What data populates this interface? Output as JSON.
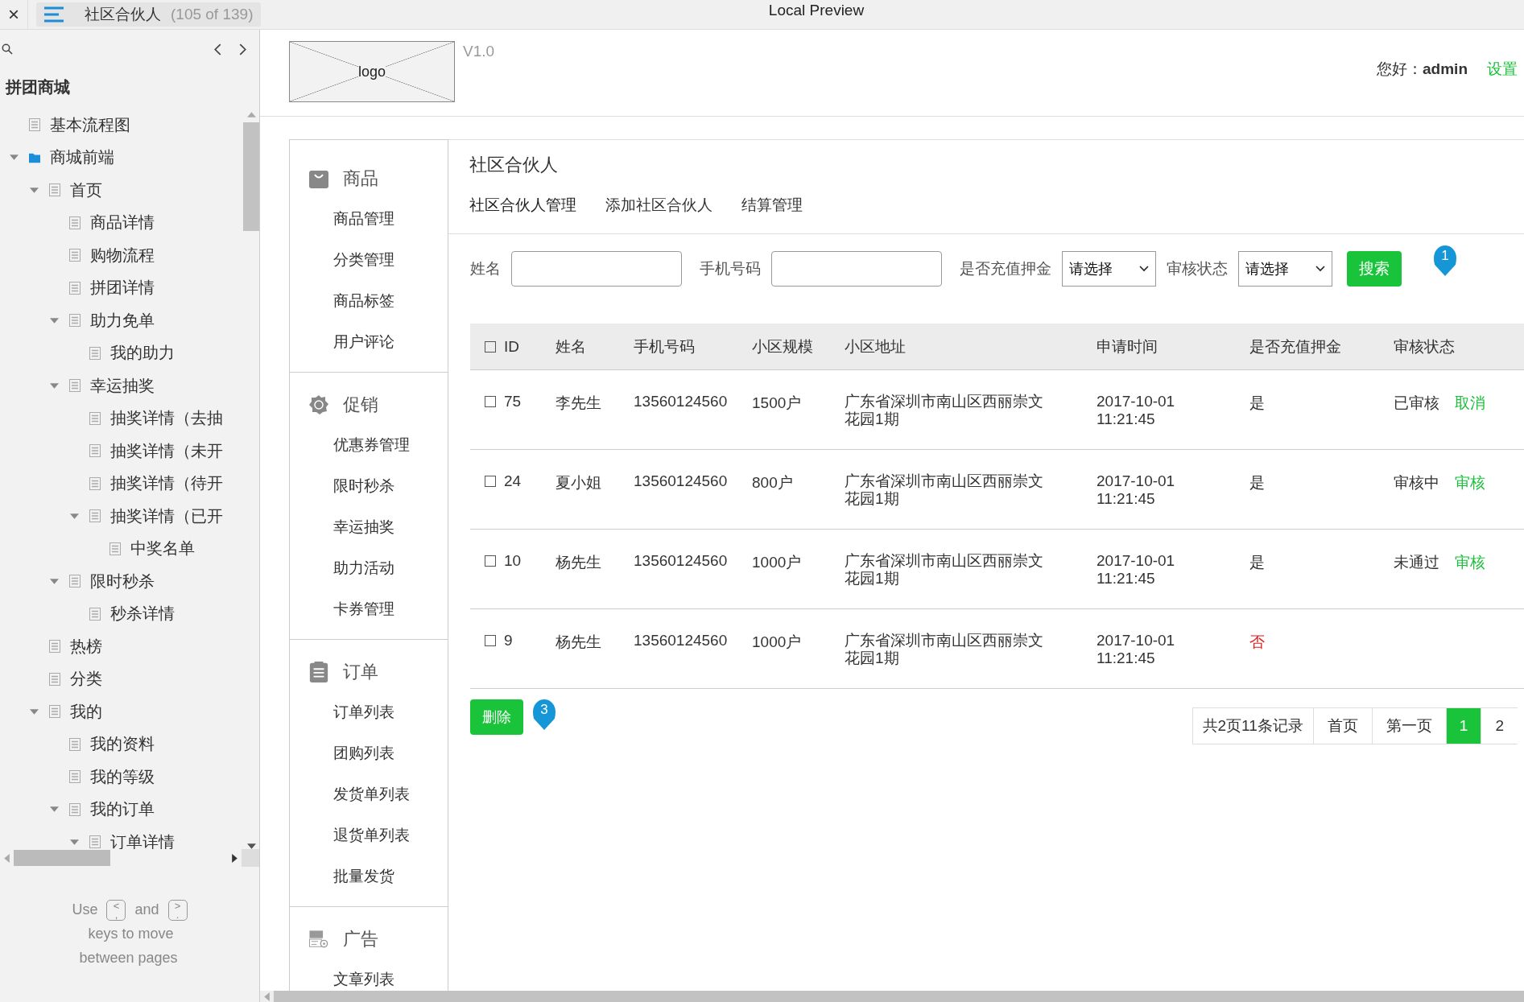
{
  "top_bar": {
    "close": "×",
    "tab_title": "社区合伙人",
    "tab_count": "(105 of 139)",
    "preview_title": "Local Preview"
  },
  "sidebar": {
    "project": "拼团商城",
    "tree": [
      {
        "label": "基本流程图",
        "kind": "page"
      },
      {
        "label": "商城前端",
        "kind": "folder",
        "expanded": true,
        "children": [
          {
            "label": "首页",
            "kind": "page",
            "expanded": true,
            "children": [
              {
                "label": "商品详情",
                "kind": "page"
              },
              {
                "label": "购物流程",
                "kind": "page"
              },
              {
                "label": "拼团详情",
                "kind": "page"
              },
              {
                "label": "助力免单",
                "kind": "page",
                "expanded": true,
                "children": [
                  {
                    "label": "我的助力",
                    "kind": "page"
                  }
                ]
              },
              {
                "label": "幸运抽奖",
                "kind": "page",
                "expanded": true,
                "children": [
                  {
                    "label": "抽奖详情（去抽",
                    "kind": "page"
                  },
                  {
                    "label": "抽奖详情（未开",
                    "kind": "page"
                  },
                  {
                    "label": "抽奖详情（待开",
                    "kind": "page"
                  },
                  {
                    "label": "抽奖详情（已开",
                    "kind": "page",
                    "expanded": true,
                    "children": [
                      {
                        "label": "中奖名单",
                        "kind": "page"
                      }
                    ]
                  }
                ]
              },
              {
                "label": "限时秒杀",
                "kind": "page",
                "expanded": true,
                "children": [
                  {
                    "label": "秒杀详情",
                    "kind": "page"
                  }
                ]
              }
            ]
          },
          {
            "label": "热榜",
            "kind": "page"
          },
          {
            "label": "分类",
            "kind": "page"
          },
          {
            "label": "我的",
            "kind": "page",
            "expanded": true,
            "children": [
              {
                "label": "我的资料",
                "kind": "page"
              },
              {
                "label": "我的等级",
                "kind": "page"
              },
              {
                "label": "我的订单",
                "kind": "page",
                "expanded": true,
                "children": [
                  {
                    "label": "订单详情",
                    "kind": "page",
                    "expanded": true
                  }
                ]
              }
            ]
          }
        ]
      }
    ],
    "help": {
      "use": "Use",
      "key_prev": [
        "<",
        ","
      ],
      "and": "and",
      "key_next": [
        ">",
        "."
      ],
      "rest": "keys to move between pages"
    }
  },
  "header": {
    "logo": "logo",
    "version": "V1.0",
    "greeting": "您好：**admin**",
    "settings": "设置"
  },
  "nav": [
    {
      "title": "商品",
      "items": [
        "商品管理",
        "分类管理",
        "商品标签",
        "用户评论"
      ]
    },
    {
      "title": "促销",
      "items": [
        "优惠券管理",
        "限时秒杀",
        "幸运抽奖",
        "助力活动",
        "卡券管理"
      ]
    },
    {
      "title": "订单",
      "items": [
        "订单列表",
        "团购列表",
        "发货单列表",
        "退货单列表",
        "批量发货"
      ]
    },
    {
      "title": "广告",
      "items": [
        "文章列表"
      ]
    }
  ],
  "content": {
    "title": "社区合伙人",
    "tabs": [
      {
        "label": "社区合伙人管理",
        "selected": true
      },
      {
        "label": "添加社区合伙人",
        "selected": false
      },
      {
        "label": "结算管理",
        "selected": false
      }
    ],
    "filters": [
      {
        "kind": "input",
        "label": "姓名"
      },
      {
        "kind": "input",
        "label": "手机号码"
      },
      {
        "kind": "select",
        "label": "是否充值押金",
        "value": "请选择"
      },
      {
        "kind": "select",
        "label": "审核状态",
        "value": "请选择"
      }
    ],
    "search_button": "搜索",
    "annotations": [
      "1",
      "3"
    ],
    "table": {
      "select_all_checked": false,
      "columns": [
        "ID",
        "姓名",
        "手机号码",
        "小区规模",
        "小区地址",
        "申请时间",
        "是否充值押金",
        "审核状态"
      ],
      "rows": [
        {
          "checked": false,
          "id": "75",
          "name": "李先生",
          "phone": "13560124560",
          "scale": "1500户",
          "address": "广东省深圳市南山区西丽崇文花园1期",
          "time": "2017-10-01 11:21:45",
          "deposit": "是",
          "deposit_paid": true,
          "status": "已审核",
          "action": "取消"
        },
        {
          "checked": false,
          "id": "24",
          "name": "夏小姐",
          "phone": "13560124560",
          "scale": "800户",
          "address": "广东省深圳市南山区西丽崇文花园1期",
          "time": "2017-10-01 11:21:45",
          "deposit": "是",
          "deposit_paid": true,
          "status": "审核中",
          "action": "审核"
        },
        {
          "checked": false,
          "id": "10",
          "name": "杨先生",
          "phone": "13560124560",
          "scale": "1000户",
          "address": "广东省深圳市南山区西丽崇文花园1期",
          "time": "2017-10-01 11:21:45",
          "deposit": "是",
          "deposit_paid": true,
          "status": "未通过",
          "action": "审核"
        },
        {
          "checked": false,
          "id": "9",
          "name": "杨先生",
          "phone": "13560124560",
          "scale": "1000户",
          "address": "广东省深圳市南山区西丽崇文花园1期",
          "time": "2017-10-01 11:21:45",
          "deposit": "否",
          "deposit_paid": false
        }
      ]
    },
    "delete_button": "删除",
    "pagination": {
      "summary": "共2页11条记录",
      "pages": [
        {
          "label": "首页",
          "selected": false
        },
        {
          "label": "第一页",
          "selected": false
        },
        {
          "label": "1",
          "selected": true
        },
        {
          "label": "2",
          "selected": false
        }
      ]
    }
  }
}
